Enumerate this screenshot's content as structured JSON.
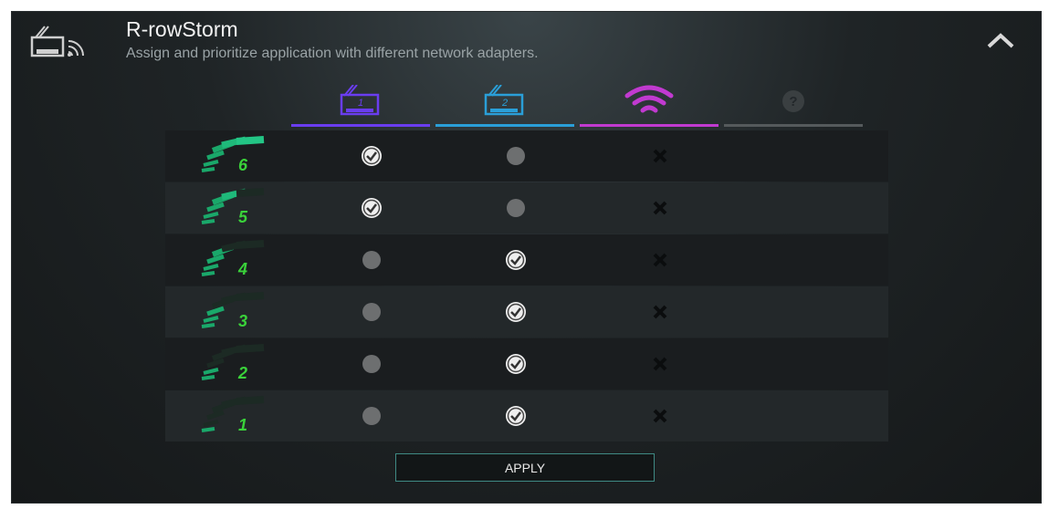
{
  "header": {
    "title": "R-rowStorm",
    "subtitle": "Assign and prioritize application with different network adapters.",
    "app_icon": "network-adapter-icon",
    "collapse_icon": "chevron-up-icon"
  },
  "columns": [
    {
      "name": "adapter-1",
      "icon": "network-adapter-1-icon",
      "label": "1",
      "color": "#6a3df0"
    },
    {
      "name": "adapter-2",
      "icon": "network-adapter-2-icon",
      "label": "2",
      "color": "#2a9fd8"
    },
    {
      "name": "wifi",
      "icon": "wifi-icon",
      "color": "#c13ad0"
    },
    {
      "name": "unknown",
      "icon": "help-icon",
      "label": "?",
      "color": "#555a5c"
    }
  ],
  "rows": [
    {
      "priority": "6",
      "adapter1": "checked",
      "adapter2": "dot",
      "wifi": "x"
    },
    {
      "priority": "5",
      "adapter1": "checked",
      "adapter2": "dot",
      "wifi": "x"
    },
    {
      "priority": "4",
      "adapter1": "dot",
      "adapter2": "checked",
      "wifi": "x"
    },
    {
      "priority": "3",
      "adapter1": "dot",
      "adapter2": "checked",
      "wifi": "x"
    },
    {
      "priority": "2",
      "adapter1": "dot",
      "adapter2": "checked",
      "wifi": "x"
    },
    {
      "priority": "1",
      "adapter1": "dot",
      "adapter2": "checked",
      "wifi": "x"
    }
  ],
  "apply_label": "APPLY",
  "colors": {
    "accent_green": "#29c27a",
    "priority_digit": "#3ad23a",
    "apply_border": "#3f8a84"
  }
}
